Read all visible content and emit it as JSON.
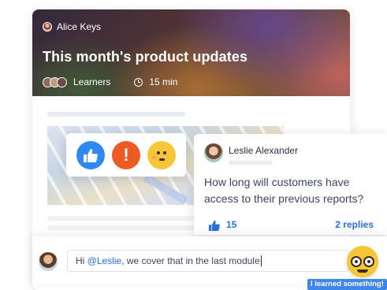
{
  "lesson": {
    "author": "Alice Keys",
    "title": "This month's product updates",
    "audience": "Learners",
    "duration": "15 min"
  },
  "reactions": {
    "options": [
      "like-icon",
      "alert-icon",
      "blushing-face-icon"
    ],
    "colors": {
      "like": "#2f89f5",
      "alert": "#ee5a24",
      "face": "#f5c636"
    },
    "alert_glyph": "!"
  },
  "comment": {
    "author": "Leslie Alexander",
    "text": "How long will customers have access to their previous reports?",
    "likes": "15",
    "replies": "2 replies"
  },
  "reply": {
    "prefix": "Hi ",
    "mention": "@Leslie",
    "suffix": ", we cover that in the last module",
    "reaction_icon": "nerd-face-icon",
    "tooltip": "I learned something!"
  }
}
